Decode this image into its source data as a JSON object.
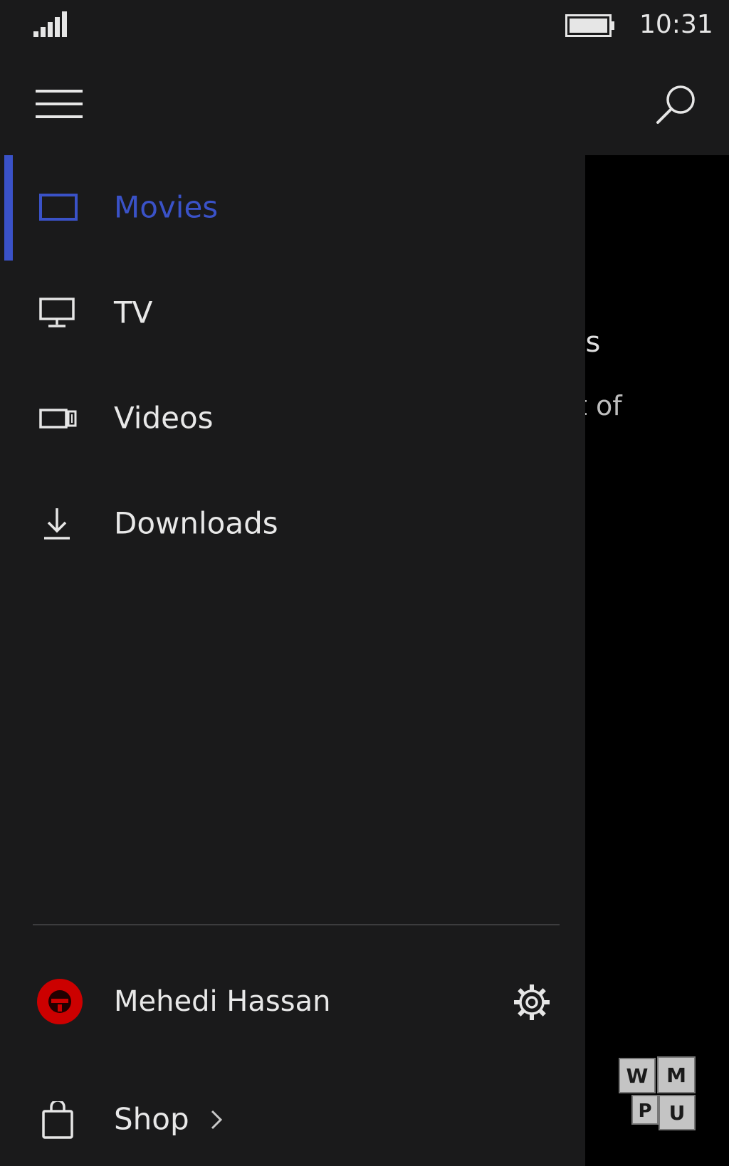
{
  "status": {
    "time": "10:31"
  },
  "icons": {
    "signal": "signal-icon",
    "battery": "battery-icon",
    "menu": "hamburger-icon",
    "search": "search-icon",
    "movies": "movies-icon",
    "tv": "tv-icon",
    "videos": "video-camera-icon",
    "downloads": "download-icon",
    "settings": "gear-icon",
    "shop": "shopping-bag-icon",
    "chevron": "chevron-right-icon"
  },
  "nav": {
    "items": [
      {
        "label": "Movies",
        "active": true
      },
      {
        "label": "TV",
        "active": false
      },
      {
        "label": "Videos",
        "active": false
      },
      {
        "label": "Downloads",
        "active": false
      }
    ]
  },
  "account": {
    "name": "Mehedi Hassan"
  },
  "shop": {
    "label": "Shop"
  },
  "background_content": {
    "title_fragment": "os",
    "text_fragment": "t of"
  },
  "watermark": {
    "letters": [
      "W",
      "M",
      "P",
      "U"
    ]
  },
  "colors": {
    "accent": "#3a52c8",
    "drawer_bg": "#1a1a1b",
    "avatar": "#cc0000"
  }
}
